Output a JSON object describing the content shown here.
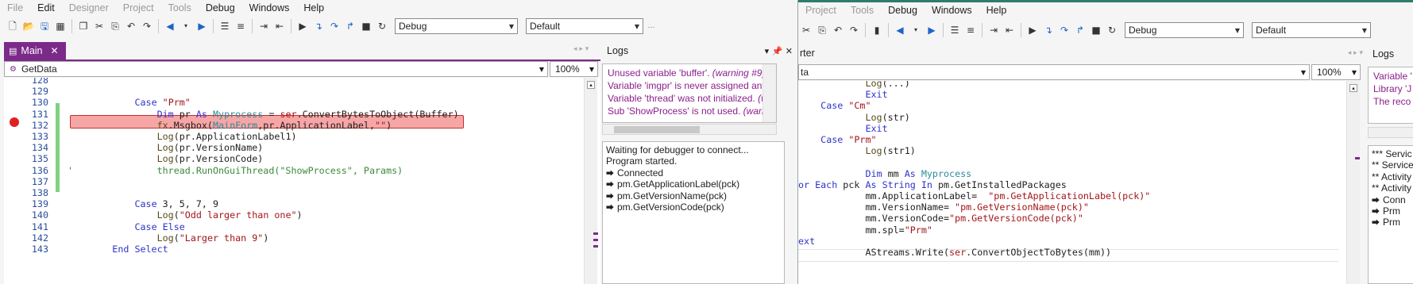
{
  "left": {
    "menu": [
      {
        "label": "File",
        "enabled": false
      },
      {
        "label": "Edit",
        "enabled": true
      },
      {
        "label": "Designer",
        "enabled": false
      },
      {
        "label": "Project",
        "enabled": false
      },
      {
        "label": "Tools",
        "enabled": false
      },
      {
        "label": "Debug",
        "enabled": true
      },
      {
        "label": "Windows",
        "enabled": true
      },
      {
        "label": "Help",
        "enabled": true
      }
    ],
    "config_combo": "Debug",
    "platform_combo": "Default",
    "tab_label": "Main",
    "sub_combo": "GetData",
    "zoom": "100%",
    "code_lines": [
      {
        "num": "128",
        "html": ""
      },
      {
        "num": "129",
        "html": ""
      },
      {
        "num": "130",
        "html": "            <span class=\"kw\">Case</span> <span class=\"str\">\"Prm\"</span>"
      },
      {
        "num": "131",
        "html": "                <span class=\"kw\">Dim</span> pr <span class=\"kw\">As</span> <span class=\"cls\">Myprocess</span> = <span class=\"str\">ser</span>.ConvertBytesToObject(Buffer)"
      },
      {
        "num": "132",
        "html": "                <span class=\"fnc\">fx</span>.Msgbox(<span class=\"cls\">MainForm</span>,pr.ApplicationLabel,<span class=\"str\">\"\"</span>)"
      },
      {
        "num": "133",
        "html": "                <span class=\"fnc\">Log</span>(pr.ApplicationLabel1)"
      },
      {
        "num": "134",
        "html": "                <span class=\"fnc\">Log</span>(pr.VersionName)"
      },
      {
        "num": "135",
        "html": "                <span class=\"fnc\">Log</span>(pr.VersionCode)"
      },
      {
        "num": "136",
        "html": "<span class=\"cm\">'               thread.RunOnGuiThread(\"ShowProcess\", Params)</span>"
      },
      {
        "num": "137",
        "html": ""
      },
      {
        "num": "138",
        "html": ""
      },
      {
        "num": "139",
        "html": "            <span class=\"kw\">Case</span> 3, 5, 7, 9"
      },
      {
        "num": "140",
        "html": "                <span class=\"fnc\">Log</span>(<span class=\"str\">\"Odd larger than one\"</span>)"
      },
      {
        "num": "141",
        "html": "            <span class=\"kw\">Case Else</span>"
      },
      {
        "num": "142",
        "html": "                <span class=\"fnc\">Log</span>(<span class=\"str\">\"Larger than 9\"</span>)"
      },
      {
        "num": "143",
        "html": "        <span class=\"kw\">End Select</span>"
      }
    ],
    "logs_title": "Logs",
    "warnings": [
      {
        "text": "Unused variable 'buffer'.",
        "tag": "(warning #9)"
      },
      {
        "text": "Variable 'imgpr' is never assigned any v",
        "tag": ""
      },
      {
        "text": "Variable 'thread' was not initialized.",
        "tag": "(w"
      },
      {
        "text": "Sub 'ShowProcess' is not used.",
        "tag": "(warnin"
      }
    ],
    "log_lines": [
      {
        "arrow": false,
        "text": "Waiting for debugger to connect..."
      },
      {
        "arrow": false,
        "text": "Program started."
      },
      {
        "arrow": true,
        "text": "Connected"
      },
      {
        "arrow": true,
        "text": "pm.GetApplicationLabel(pck)"
      },
      {
        "arrow": true,
        "text": "pm.GetVersionName(pck)"
      },
      {
        "arrow": true,
        "text": "pm.GetVersionCode(pck)"
      }
    ]
  },
  "right": {
    "menu": [
      {
        "label": "Project",
        "enabled": false
      },
      {
        "label": "Tools",
        "enabled": false
      },
      {
        "label": "Debug",
        "enabled": true
      },
      {
        "label": "Windows",
        "enabled": true
      },
      {
        "label": "Help",
        "enabled": true
      }
    ],
    "config_combo": "Debug",
    "platform_combo": "Default",
    "tab_partial": "rter",
    "sub_combo": "ta",
    "zoom": "100%",
    "code_lines": [
      {
        "html": "            <span class=\"fnc\">Log</span>(...)"
      },
      {
        "html": "            <span class=\"kw\">Exit</span>"
      },
      {
        "html": "    <span class=\"kw\">Case</span> <span class=\"str\">\"Cm\"</span>"
      },
      {
        "html": "            <span class=\"fnc\">Log</span>(str)"
      },
      {
        "html": "            <span class=\"kw\">Exit</span>"
      },
      {
        "html": "    <span class=\"kw\">Case</span> <span class=\"str\">\"Prm\"</span>"
      },
      {
        "html": "            <span class=\"fnc\">Log</span>(str1)"
      },
      {
        "html": ""
      },
      {
        "html": "            <span class=\"kw\">Dim</span> mm <span class=\"kw\">As</span> <span class=\"cls\">Myprocess</span>"
      },
      {
        "html": "<span class=\"kw\">or Each</span> pck <span class=\"kw\">As String In</span> pm.GetInstalledPackages"
      },
      {
        "html": "            mm.ApplicationLabel=  <span class=\"str\">\"pm.GetApplicationLabel(pck)\"</span>"
      },
      {
        "html": "            mm.VersionName= <span class=\"str\">\"pm.GetVersionName(pck)\"</span>"
      },
      {
        "html": "            mm.VersionCode=<span class=\"str\">\"pm.GetVersionCode(pck)\"</span>"
      },
      {
        "html": "            mm.spl=<span class=\"str\">\"Prm\"</span>"
      },
      {
        "html": "<span class=\"kw\">ext</span>"
      },
      {
        "html": "            AStreams.Write(<span class=\"str\">ser</span>.ConvertObjectToBytes(mm))"
      }
    ],
    "logs_title": "Logs",
    "warnings": [
      {
        "text": "Variable '",
        "tag": ""
      },
      {
        "text": "Library 'J",
        "tag": ""
      },
      {
        "text": "The reco",
        "tag": ""
      }
    ],
    "log_lines": [
      {
        "arrow": false,
        "text": "*** Servic"
      },
      {
        "arrow": false,
        "text": "** Service"
      },
      {
        "arrow": false,
        "text": "** Activity"
      },
      {
        "arrow": false,
        "text": "** Activity"
      },
      {
        "arrow": true,
        "text": "Conn"
      },
      {
        "arrow": true,
        "text": "Prm"
      },
      {
        "arrow": true,
        "text": "Prm"
      }
    ]
  }
}
